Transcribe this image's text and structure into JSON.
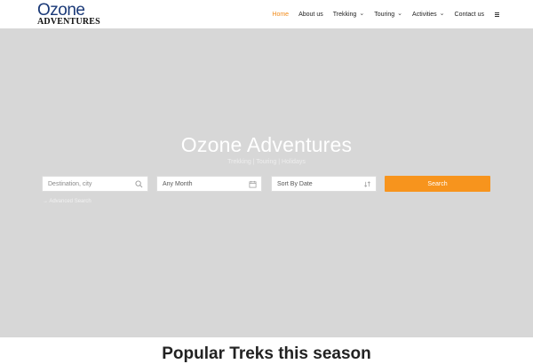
{
  "logo": {
    "top": "Ozone",
    "bottom": "ADVENTURES"
  },
  "nav": {
    "items": [
      {
        "label": "Home"
      },
      {
        "label": "About us"
      },
      {
        "label": "Trekking"
      },
      {
        "label": "Touring"
      },
      {
        "label": "Activities"
      },
      {
        "label": "Contact us"
      }
    ]
  },
  "hero": {
    "title": "Ozone Adventures",
    "subtitle": "Trekking | Touring | Holidays"
  },
  "search": {
    "destination_placeholder": "Destination, city",
    "month_value": "Any Month",
    "sort_value": "Sort By Date",
    "button_label": "Search",
    "advanced_label": "→ Advanced Search"
  },
  "section": {
    "title": "Popular Treks this season"
  },
  "colors": {
    "accent": "#f7941d",
    "hero_bg": "#d7d7d7",
    "logo_blue": "#1b3a78"
  }
}
